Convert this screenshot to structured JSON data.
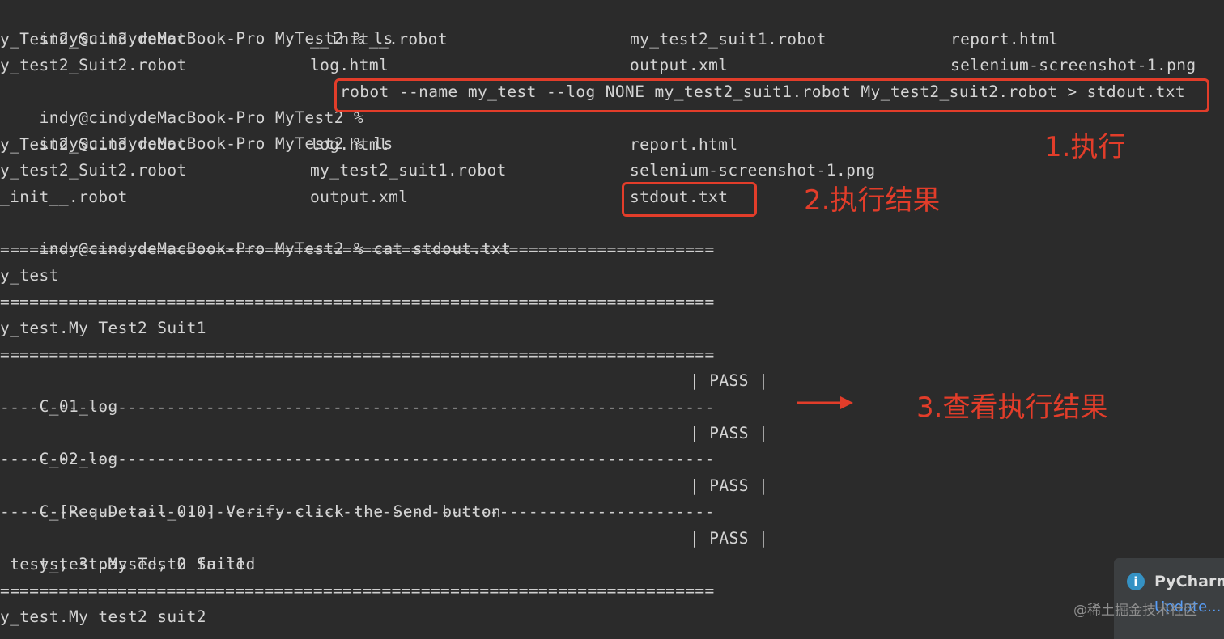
{
  "terminal": {
    "prompt": "indy@cindydeMacBook-Pro MyTest2 %",
    "cmd_ls": " ls",
    "ls1": {
      "row1": [
        "y_Test2_Suit3.robot",
        "__init__.robot",
        "my_test2_suit1.robot",
        "report.html"
      ],
      "row2": [
        "y_test2_Suit2.robot",
        "log.html",
        "output.xml",
        "selenium-screenshot-1.png"
      ]
    },
    "cmd_robot": "robot --name my_test --log NONE my_test2_suit1.robot My_test2_suit2.robot > stdout.txt",
    "ls2": {
      "row1": [
        "y_Test2_Suit3.robot",
        "log.html",
        "report.html"
      ],
      "row2": [
        "y_test2_Suit2.robot",
        "my_test2_suit1.robot",
        "selenium-screenshot-1.png"
      ],
      "row3": [
        "_init__.robot",
        "output.xml",
        "stdout.txt"
      ]
    },
    "cmd_cat": " cat stdout.txt",
    "eq_rule": "=========================================================================",
    "dash_rule": "-------------------------------------------------------------------------",
    "suite_top": "y_test",
    "suite1": "y_test.My Test2 Suit1",
    "tests": [
      {
        "name": "C_01_log",
        "status": "| PASS |"
      },
      {
        "name": "C_02_log",
        "status": "| PASS |"
      },
      {
        "name": "C_[RequDetail_010] Verify click the Send button",
        "status": "| PASS |"
      }
    ],
    "suite1_result_name": "y_test.My Test2 Suit1",
    "suite1_result_status": "| PASS |",
    "suite1_summary": " tests, 3 passed, 0 failed",
    "suite2": "y_test.My test2 suit2"
  },
  "annotations": {
    "step1": "1.执行",
    "step2": "2.执行结果",
    "step3": "3.查看执行结果",
    "color": "#e23d2a"
  },
  "notification": {
    "icon": "info-icon",
    "title": "PyCharm",
    "link": "Update..."
  },
  "watermark": "@稀土掘金技术社区"
}
